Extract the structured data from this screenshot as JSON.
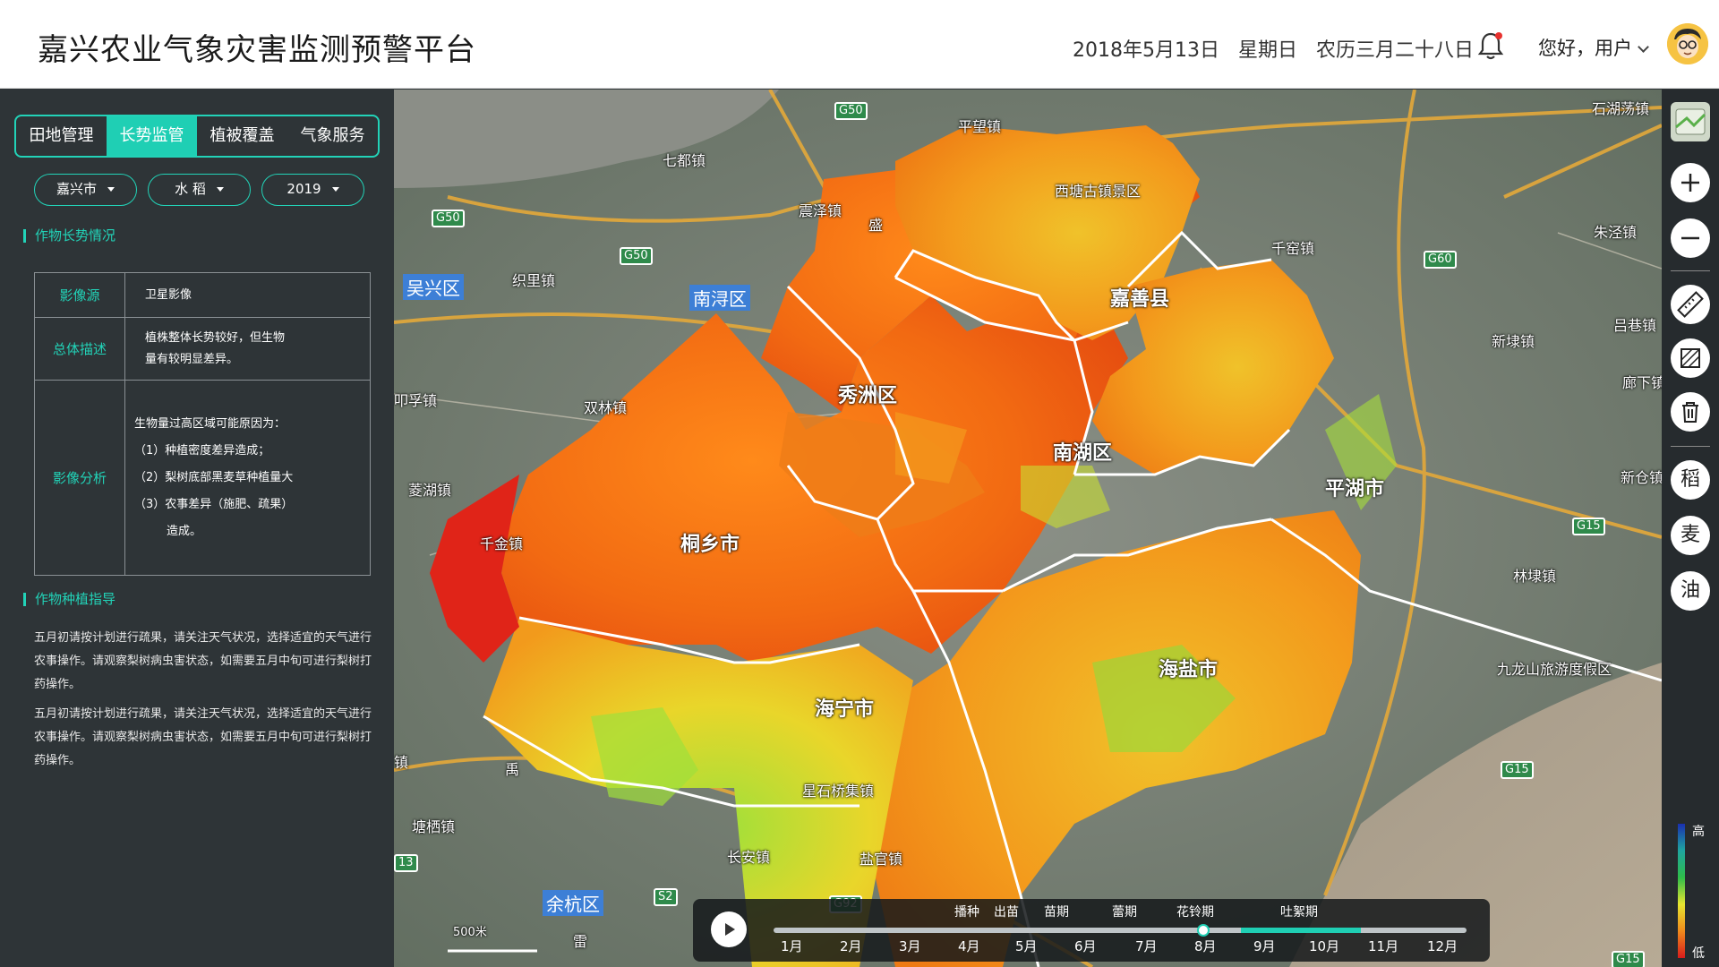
{
  "header": {
    "title": "嘉兴农业气象灾害监测预警平台",
    "date": "2018年5月13日",
    "weekday": "星期日",
    "lunar": "农历三月二十八日",
    "greeting": "您好，用户"
  },
  "sidebar": {
    "tabs": [
      {
        "label": "田地管理"
      },
      {
        "label": "长势监管"
      },
      {
        "label": "植被覆盖"
      },
      {
        "label": "气象服务"
      }
    ],
    "active_tab": "长势监管",
    "filters": {
      "city": "嘉兴市",
      "crop": "水 稻",
      "year": "2019"
    },
    "growth_section": {
      "title": "作物长势情况",
      "rows": {
        "source": {
          "key": "影像源",
          "value": "卫星影像"
        },
        "overall": {
          "key": "总体描述",
          "line1": "植株整体长势较好，但生物",
          "line2": "量有较明显差异。"
        },
        "analysis": {
          "key": "影像分析",
          "lines": [
            "生物量过高区域可能原因为：",
            "（1）种植密度差异造成；",
            "（2）梨树底部黑麦草种植量大",
            "（3）农事差异（施肥、疏果）",
            "造成。"
          ]
        }
      }
    },
    "guide_section": {
      "title": "作物种植指导",
      "paragraphs": [
        "五月初请按计划进行疏果，请关注天气状况，选择适宜的天气进行农事操作。请观察梨树病虫害状态，如需要五月中旬可进行梨树打药操作。",
        "五月初请按计划进行疏果，请关注天气状况，选择适宜的天气进行农事操作。请观察梨树病虫害状态，如需要五月中旬可进行梨树打药操作。"
      ]
    }
  },
  "map": {
    "districts": {
      "jiashan": "嘉善县",
      "xiuzhou": "秀洲区",
      "nanhu": "南湖区",
      "pinghu": "平湖市",
      "tongxiang": "桐乡市",
      "haiyan": "海盐市",
      "haining": "海宁市"
    },
    "towns": {
      "shidu": "七都镇",
      "zhenze": "震泽镇",
      "pingwang": "平望镇",
      "xitang": "西塘古镇景区",
      "qianjiao": "千窑镇",
      "zhujing": "朱泾镇",
      "wuxing": "吴兴区",
      "nanxun": "南浔区",
      "zhili": "织里镇",
      "shuanglin": "双林镇",
      "lingu": "叩孚镇",
      "linghu": "菱湖镇",
      "qianjin": "千金镇",
      "xinbang": "新埭镇",
      "lvxiang": "吕巷镇",
      "langxia": "廊下镇",
      "xincang": "新仓镇",
      "linbai": "林埭镇",
      "jiulongshan": "九龙山旅游度假区",
      "shishengtang": "石湖荡镇",
      "tangqi": "塘栖镇",
      "changan": "长安镇",
      "yanguan": "盐官镇",
      "xingshiqiao": "星石桥集镇",
      "yuhang": "余杭区",
      "yu": "禹",
      "zhen": "镇",
      "sheng": "盛",
      "lei": "雷"
    },
    "roads": [
      "G50",
      "G50",
      "G50",
      "G60",
      "G92",
      "G15",
      "G15",
      "G15",
      "S2",
      "13"
    ],
    "scale_label": "500米"
  },
  "toolbar": {
    "crop_rice": "稻",
    "crop_wheat": "麦",
    "crop_oil": "油"
  },
  "timeline": {
    "stages": [
      "播种",
      "出苗",
      "苗期",
      "蕾期",
      "花铃期",
      "吐絮期"
    ],
    "months": [
      "1月",
      "2月",
      "3月",
      "4月",
      "5月",
      "6月",
      "7月",
      "8月",
      "9月",
      "10月",
      "11月",
      "12月"
    ],
    "current_position": 0.62
  },
  "legend": {
    "high": "高",
    "low": "低"
  },
  "colors": {
    "accent": "#1fcfb4",
    "sidebar_bg": "#2e3437",
    "header_bg": "#ffffff"
  }
}
